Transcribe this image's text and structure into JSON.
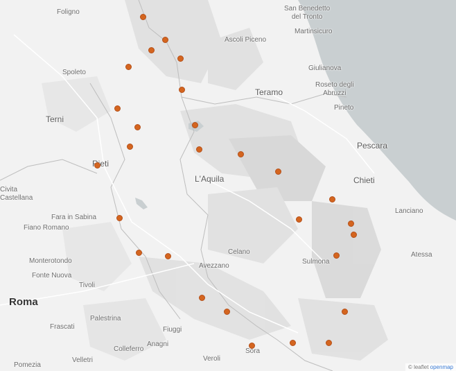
{
  "map": {
    "colors": {
      "land": "#f2f2f2",
      "sea": "#c9cfd1",
      "relief": "#dcdcdc",
      "marker": "#d4651f"
    },
    "places": [
      {
        "id": "foligno",
        "name": "Foligno",
        "size": "small"
      },
      {
        "id": "san-benedetto-del-tronto",
        "name": "San Benedetto\ndel Tronto",
        "size": "small"
      },
      {
        "id": "martinsicuro",
        "name": "Martinsicuro",
        "size": "small"
      },
      {
        "id": "ascoli-piceno",
        "name": "Ascoli Piceno",
        "size": "small"
      },
      {
        "id": "spoleto",
        "name": "Spoleto",
        "size": "small"
      },
      {
        "id": "giulianova",
        "name": "Giulianova",
        "size": "small"
      },
      {
        "id": "teramo",
        "name": "Teramo",
        "size": "mid"
      },
      {
        "id": "roseto-degli-abruzzi",
        "name": "Roseto degli\nAbruzzi",
        "size": "small"
      },
      {
        "id": "pineto",
        "name": "Pineto",
        "size": "small"
      },
      {
        "id": "terni",
        "name": "Terni",
        "size": "mid"
      },
      {
        "id": "pescara",
        "name": "Pescara",
        "size": "mid"
      },
      {
        "id": "rieti",
        "name": "Rieti",
        "size": "mid"
      },
      {
        "id": "laquila",
        "name": "L'Aquila",
        "size": "mid"
      },
      {
        "id": "chieti",
        "name": "Chieti",
        "size": "mid"
      },
      {
        "id": "civita-castellana",
        "name": "Civita\nCastellana",
        "size": "small"
      },
      {
        "id": "lanciano",
        "name": "Lanciano",
        "size": "small"
      },
      {
        "id": "fara-in-sabina",
        "name": "Fara in Sabina",
        "size": "small"
      },
      {
        "id": "fiano-romano",
        "name": "Fiano Romano",
        "size": "small"
      },
      {
        "id": "celano",
        "name": "Celano",
        "size": "small"
      },
      {
        "id": "monterotondo",
        "name": "Monterotondo",
        "size": "small"
      },
      {
        "id": "sulmona",
        "name": "Sulmona",
        "size": "small"
      },
      {
        "id": "atessa",
        "name": "Atessa",
        "size": "small"
      },
      {
        "id": "avezzano",
        "name": "Avezzano",
        "size": "small"
      },
      {
        "id": "fonte-nuova",
        "name": "Fonte Nuova",
        "size": "small"
      },
      {
        "id": "tivoli",
        "name": "Tivoli",
        "size": "small"
      },
      {
        "id": "roma",
        "name": "Roma",
        "size": "major"
      },
      {
        "id": "palestrina",
        "name": "Palestrina",
        "size": "small"
      },
      {
        "id": "frascati",
        "name": "Frascati",
        "size": "small"
      },
      {
        "id": "fiuggi",
        "name": "Fiuggi",
        "size": "small"
      },
      {
        "id": "anagni",
        "name": "Anagni",
        "size": "small"
      },
      {
        "id": "colleferro",
        "name": "Colleferro",
        "size": "small"
      },
      {
        "id": "sora",
        "name": "Sora",
        "size": "small"
      },
      {
        "id": "veroli",
        "name": "Veroli",
        "size": "small"
      },
      {
        "id": "velletri",
        "name": "Velletri",
        "size": "small"
      },
      {
        "id": "pomezia",
        "name": "Pomezia",
        "size": "small"
      }
    ],
    "markers_count": 29,
    "attribution": {
      "text": "© leaflet ",
      "link": "openmap"
    }
  }
}
